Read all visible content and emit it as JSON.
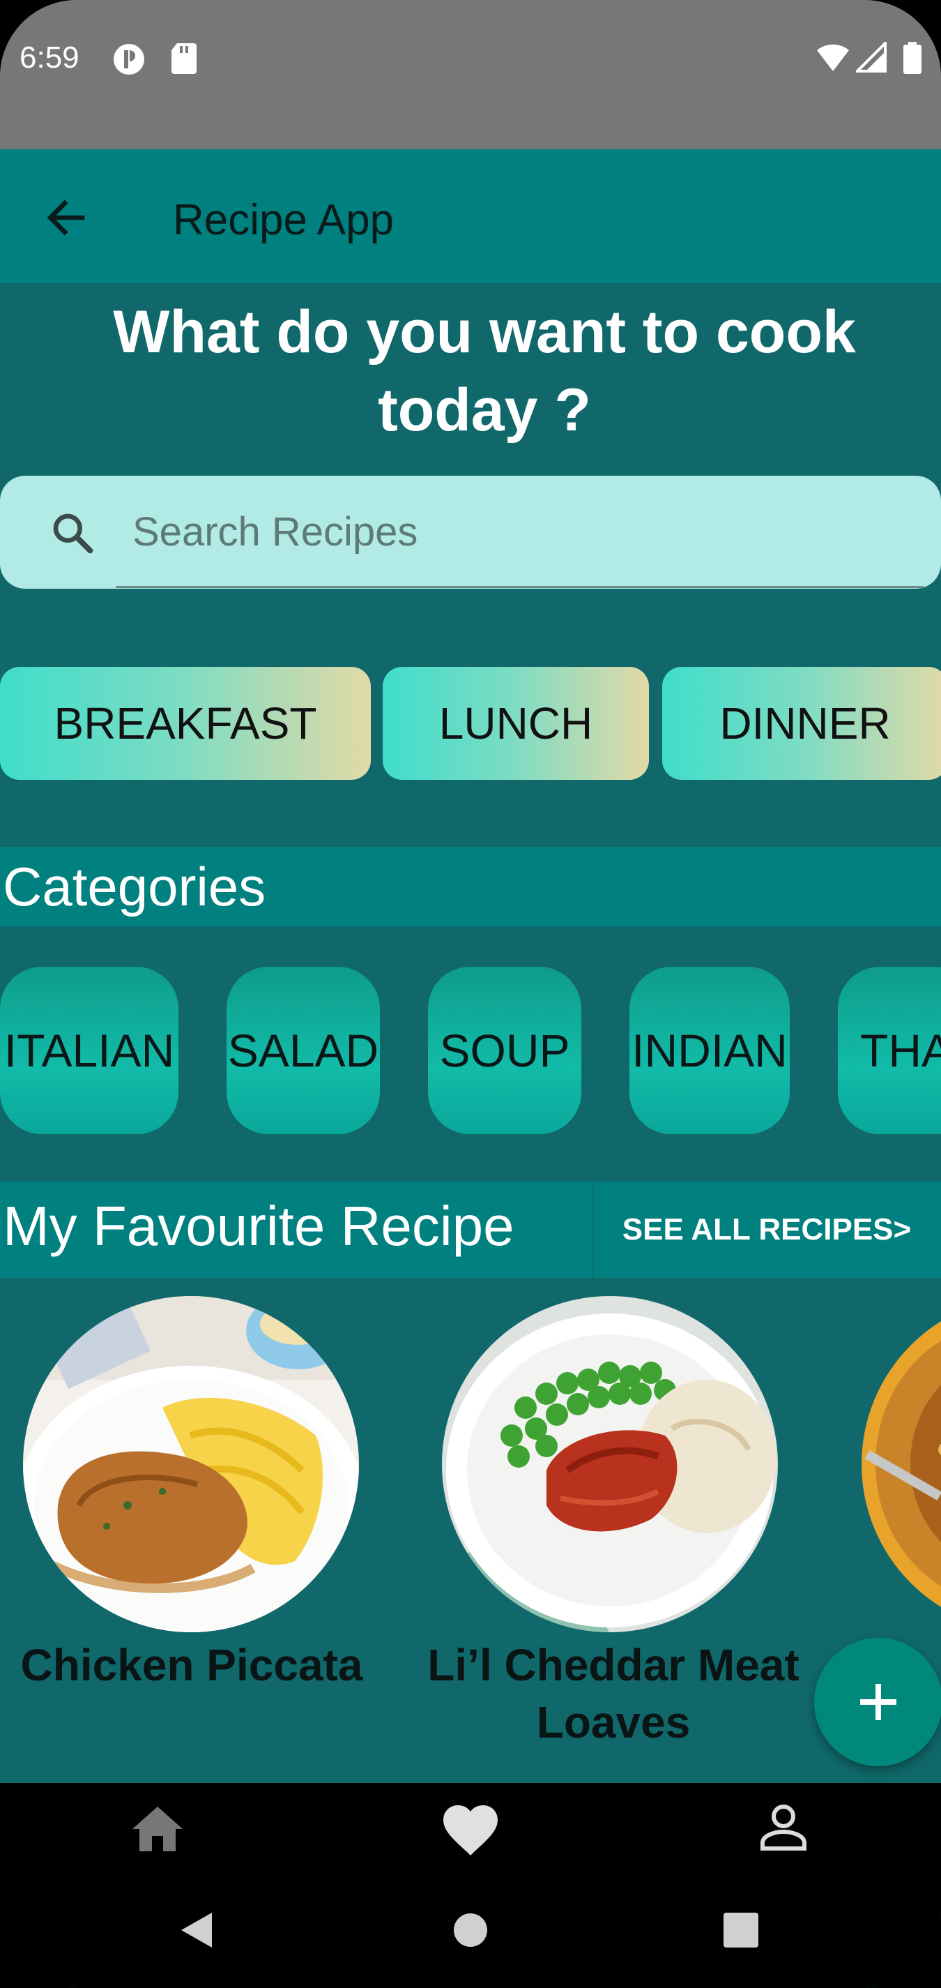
{
  "status_bar": {
    "time": "6:59"
  },
  "app_bar": {
    "title": "Recipe App"
  },
  "headline": {
    "line1": "What do you want to cook",
    "line2": "today ?"
  },
  "search": {
    "placeholder": "Search Recipes"
  },
  "meal_types": [
    "BREAKFAST",
    "LUNCH",
    "DINNER"
  ],
  "categories": {
    "title": "Categories",
    "items": [
      "ITALIAN",
      "SALAD",
      "SOUP",
      "INDIAN",
      "THA"
    ]
  },
  "favourites": {
    "title": "My Favourite Recipe",
    "see_all_label": "SEE ALL RECIPES>",
    "recipes": [
      {
        "name_line1": "Chicken Piccata",
        "name_line2": ""
      },
      {
        "name_line1": "Li’l Cheddar Meat",
        "name_line2": "Loaves"
      }
    ]
  },
  "colors": {
    "app_bar": "#00807f",
    "background": "#10686a",
    "search_bg": "#b2ebe5",
    "fab": "#00897b"
  },
  "bottom_nav": {
    "icons": [
      "home-icon",
      "heart-icon",
      "person-icon"
    ]
  },
  "system_nav": {
    "icons": [
      "back-triangle-icon",
      "home-circle-icon",
      "recents-square-icon"
    ]
  }
}
